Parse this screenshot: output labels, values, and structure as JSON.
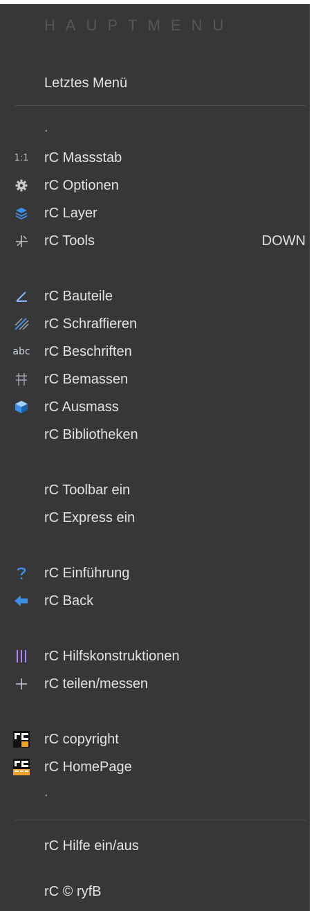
{
  "menu": {
    "title": "HAUPTMENU",
    "last_menu": "Letztes Menü",
    "dot": ".",
    "items": [
      {
        "label": "rC Massstab",
        "icon": "scale-1-1-icon",
        "icon_text": "1:1"
      },
      {
        "label": "rC Optionen",
        "icon": "gear-icon"
      },
      {
        "label": "rC Layer",
        "icon": "layers-icon"
      },
      {
        "label": "rC Tools",
        "icon": "tools-icon",
        "shortcut": "DOWN"
      },
      {
        "label": "rC Bauteile",
        "icon": "wall-icon"
      },
      {
        "label": "rC Schraffieren",
        "icon": "hatch-icon"
      },
      {
        "label": "rC Beschriften",
        "icon": "text-abc-icon",
        "icon_text": "abc"
      },
      {
        "label": "rC Bemassen",
        "icon": "dimension-icon"
      },
      {
        "label": "rC Ausmass",
        "icon": "cube-icon"
      },
      {
        "label": "rC Bibliotheken"
      },
      {
        "label": "rC Toolbar ein"
      },
      {
        "label": "rC Express ein"
      },
      {
        "label": "rC Einführung",
        "icon": "question-icon"
      },
      {
        "label": "rC Back",
        "icon": "back-arrow-icon"
      },
      {
        "label": "rC Hilfskonstruktionen",
        "icon": "vertical-lines-icon"
      },
      {
        "label": "rC teilen/messen",
        "icon": "plus-icon"
      },
      {
        "label": "rC copyright",
        "icon": "rc-logo-icon"
      },
      {
        "label": "rC HomePage",
        "icon": "rc-web-logo-icon"
      },
      {
        "label": "rC Hilfe ein/aus"
      },
      {
        "label": "rC © ryfB"
      }
    ]
  },
  "colors": {
    "background": "#373737",
    "text": "#e2e2e2",
    "title": "#565656",
    "separator": "#4f4f4f",
    "accent_blue": "#3d8ee6"
  }
}
